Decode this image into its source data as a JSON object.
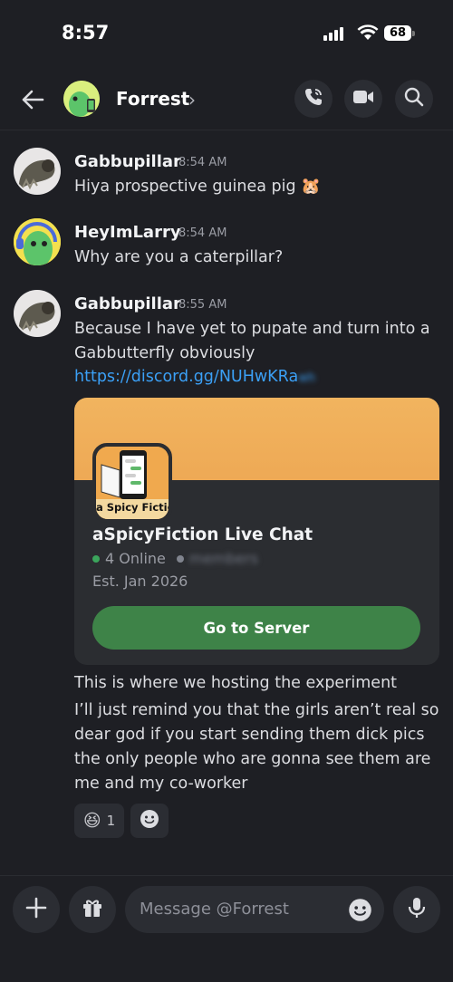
{
  "status_bar": {
    "time": "8:57",
    "battery": "68"
  },
  "header": {
    "title": "Forrest",
    "chevron": "›",
    "icons": [
      "back-arrow-icon",
      "phone-icon",
      "video-icon",
      "search-icon"
    ]
  },
  "messages": [
    {
      "author": "Gabbupillar",
      "time": "8:54 AM",
      "text": "Hiya prospective guinea pig 🐹"
    },
    {
      "author": "HeyImLarry",
      "time": "8:54 AM",
      "text": "Why are you a caterpillar?"
    },
    {
      "author": "Gabbupillar",
      "time": "8:55 AM",
      "lines": [
        "Because I have yet to pupate and turn into a",
        "Gabbutterfly obviously"
      ],
      "link": "https://discord.gg/NUHwKRa",
      "link_hidden": "wh",
      "followups": [
        "This is where we hosting the experiment",
        "I’ll just remind you that the girls aren’t real so",
        "dear god if you start sending them dick pics",
        "the only people who are gonna see them are",
        "me and my co-worker"
      ]
    }
  ],
  "invite": {
    "icon_text": "a Spicy Fiction",
    "server_name": "aSpicyFiction Live Chat",
    "online": "4 Online",
    "members_hidden": "members",
    "established": "Est. Jan 2026",
    "button": "Go to Server",
    "colors": {
      "banner": "#f1b45f",
      "button": "#3e8348",
      "online_dot": "#3ba55c"
    }
  },
  "reactions": [
    {
      "emoji": "😆",
      "count": "1"
    },
    {
      "emoji": "add-reaction-icon",
      "count": ""
    }
  ],
  "composer": {
    "placeholder": "Message @Forrest"
  }
}
